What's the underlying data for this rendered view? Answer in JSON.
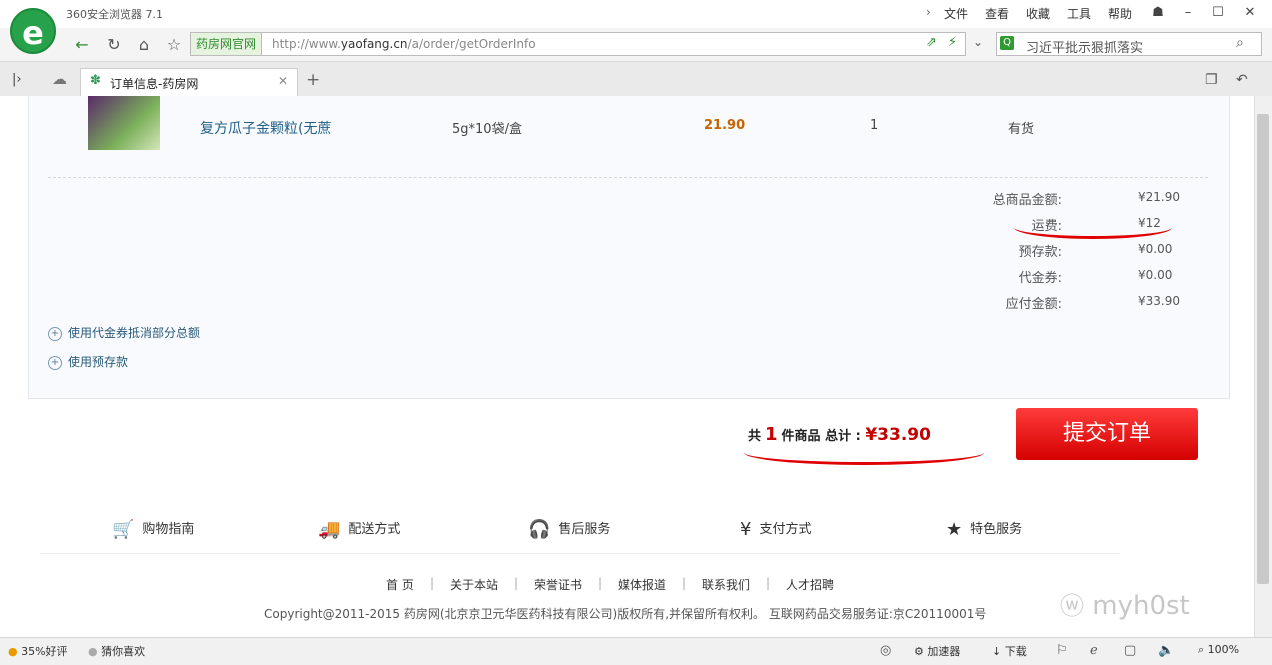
{
  "browser": {
    "app_title": "360安全浏览器 7.1",
    "menu": [
      "文件",
      "查看",
      "收藏",
      "工具",
      "帮助"
    ],
    "site_tag": "药房网官网",
    "url_prefix": "http://www.",
    "url_domain": "yaofang.cn",
    "url_path": "/a/order/getOrderInfo",
    "search_text": "习近平批示狠抓落实",
    "tab_title": "订单信息-药房网"
  },
  "product": {
    "name": "复方瓜子金颗粒(无蔗",
    "spec": "5g*10袋/盒",
    "price": "21.90",
    "qty": "1",
    "stock": "有货"
  },
  "summary": [
    {
      "label": "总商品金额:",
      "value": "¥21.90"
    },
    {
      "label": "运费:",
      "value": "¥12"
    },
    {
      "label": "预存款:",
      "value": "¥0.00"
    },
    {
      "label": "代金券:",
      "value": "¥0.00"
    },
    {
      "label": "应付金额:",
      "value": "¥33.90"
    }
  ],
  "options": {
    "use_coupon": "使用代金券抵消部分总额",
    "use_deposit": "使用预存款"
  },
  "total": {
    "prefix": "共",
    "count": "1",
    "middle": "件商品 总计 :",
    "amount": "¥33.90"
  },
  "submit_label": "提交订单",
  "services": [
    {
      "icon": "cart-icon",
      "label": "购物指南"
    },
    {
      "icon": "truck-icon",
      "label": "配送方式"
    },
    {
      "icon": "headphones-icon",
      "label": "售后服务"
    },
    {
      "icon": "yen-icon",
      "label": "支付方式"
    },
    {
      "icon": "star-icon",
      "label": "特色服务"
    }
  ],
  "footer_links": [
    "首 页",
    "关于本站",
    "荣誉证书",
    "媒体报道",
    "联系我们",
    "人才招聘"
  ],
  "copyright": "Copyright@2011-2015 药房网(北京京卫元华医药科技有限公司)版权所有,并保留所有权利。 互联网药品交易服务证:京C20110001号",
  "watermark": "myh0st",
  "statusbar": {
    "left1": "35%好评",
    "left2": "猜你喜欢",
    "accelerator": "加速器",
    "download": "下载",
    "zoom": "100%"
  },
  "colors": {
    "accent_red": "#d40000",
    "brand_green": "#27a24a",
    "price_orange": "#c86400"
  }
}
